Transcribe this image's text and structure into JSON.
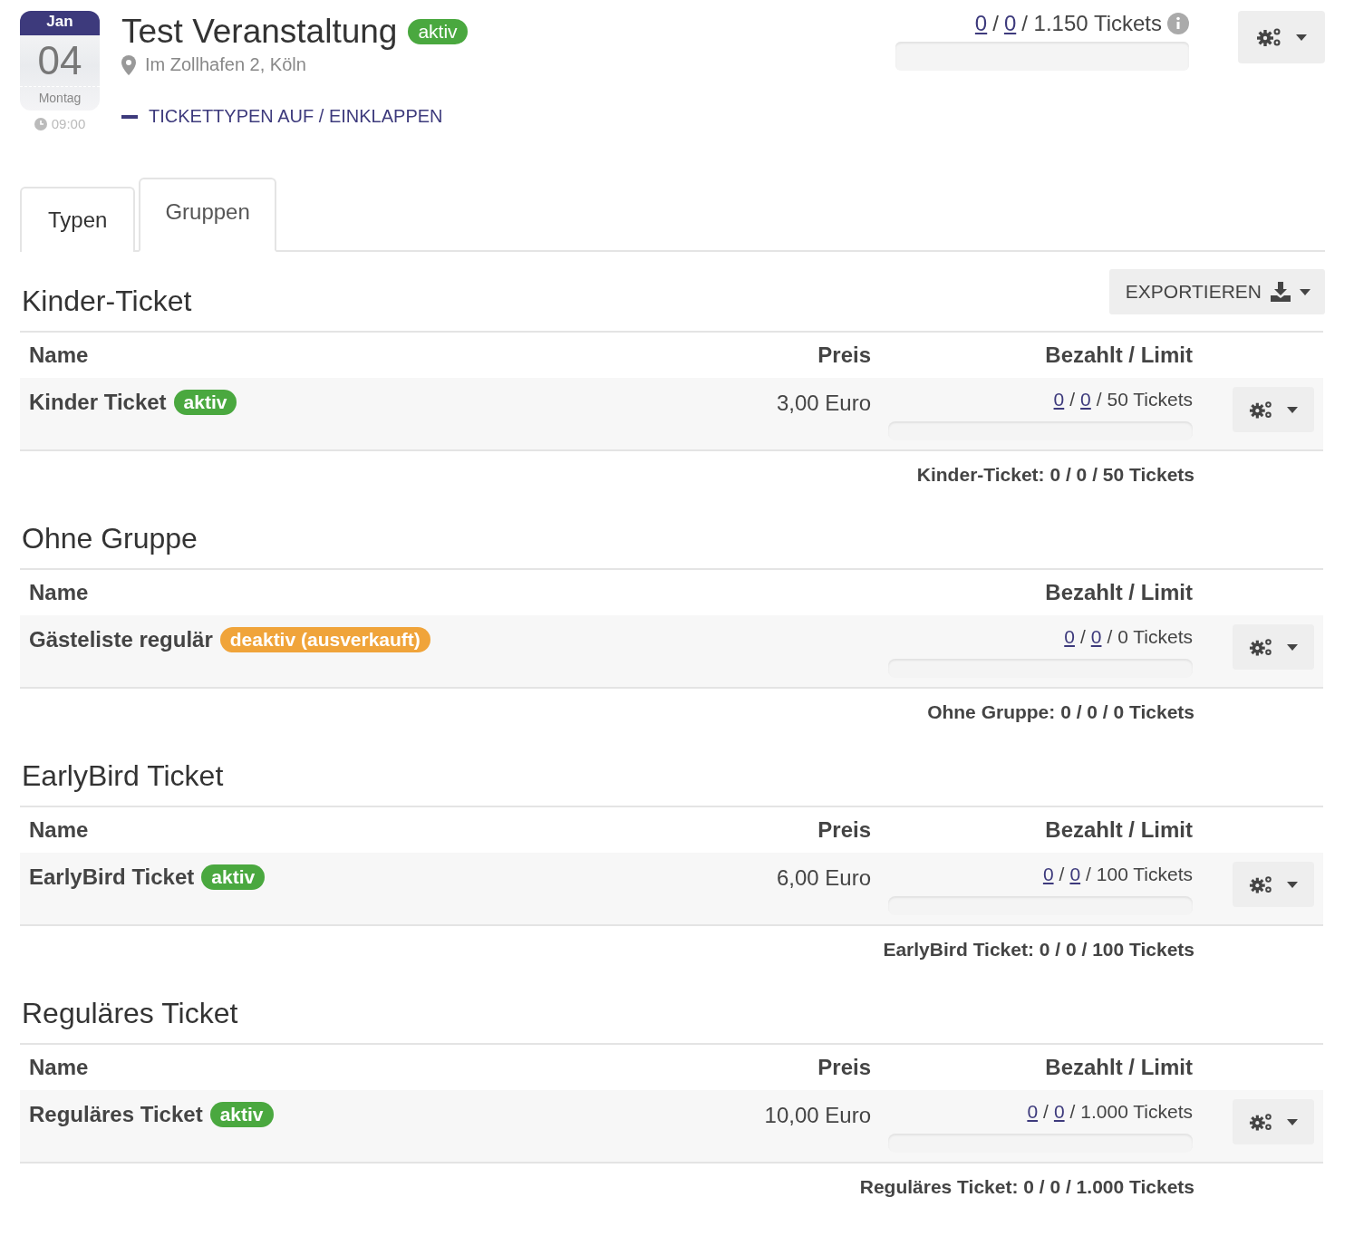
{
  "event": {
    "month": "Jan",
    "day": "04",
    "weekday": "Montag",
    "time": "09:00",
    "title": "Test Veranstaltung",
    "badge": {
      "label": "aktiv",
      "color": "#4aa83f"
    },
    "location": "Im Zollhafen 2, Köln",
    "toggle_link": "TICKETTYPEN AUF / EINKLAPPEN",
    "counts": [
      {
        "text": "0",
        "link": true
      },
      {
        "text": "/",
        "link": false
      },
      {
        "text": "0",
        "link": true
      },
      {
        "text": "/ 1.150 Tickets",
        "link": false
      }
    ],
    "level": 0
  },
  "tabs": [
    {
      "label": "Typen",
      "selected": false
    },
    {
      "label": "Gruppen",
      "selected": true
    }
  ],
  "export_button": "EXPORTIEREN",
  "groups": [
    {
      "title": "Kinder-Ticket",
      "columns": [
        "Name",
        "Preis",
        "Bezahlt / Limit"
      ],
      "rows": [
        {
          "name": "Kinder Ticket",
          "badge": {
            "label": "aktiv",
            "color": "#4aa83f"
          },
          "price": "3,00 Euro",
          "counts": [
            {
              "text": "0",
              "link": true
            },
            {
              "text": "/",
              "link": false
            },
            {
              "text": "0",
              "link": true
            },
            {
              "text": "/ 50 Tickets",
              "link": false
            }
          ],
          "level": 0
        }
      ],
      "summary": "Kinder-Ticket: 0 / 0 / 50 Tickets"
    },
    {
      "title": "Ohne Gruppe",
      "columns": [
        "Name",
        "Bezahlt / Limit"
      ],
      "rows": [
        {
          "name": "Gästeliste regulär",
          "badge": {
            "label": "deaktiv (ausverkauft)",
            "color": "#f0a43a"
          },
          "counts": [
            {
              "text": "0",
              "link": true
            },
            {
              "text": "/",
              "link": false
            },
            {
              "text": "0",
              "link": true
            },
            {
              "text": "/ 0 Tickets",
              "link": false
            }
          ],
          "level": 0
        }
      ],
      "summary": "Ohne Gruppe: 0 / 0 / 0 Tickets"
    },
    {
      "title": "EarlyBird Ticket",
      "columns": [
        "Name",
        "Preis",
        "Bezahlt / Limit"
      ],
      "rows": [
        {
          "name": "EarlyBird Ticket",
          "badge": {
            "label": "aktiv",
            "color": "#4aa83f"
          },
          "price": "6,00 Euro",
          "counts": [
            {
              "text": "0",
              "link": true
            },
            {
              "text": "/",
              "link": false
            },
            {
              "text": "0",
              "link": true
            },
            {
              "text": "/ 100 Tickets",
              "link": false
            }
          ],
          "level": 0
        }
      ],
      "summary": "EarlyBird Ticket: 0 / 0 / 100 Tickets"
    },
    {
      "title": "Reguläres Ticket",
      "columns": [
        "Name",
        "Preis",
        "Bezahlt / Limit"
      ],
      "rows": [
        {
          "name": "Reguläres Ticket",
          "badge": {
            "label": "aktiv",
            "color": "#4aa83f"
          },
          "price": "10,00 Euro",
          "counts": [
            {
              "text": "0",
              "link": true
            },
            {
              "text": "/",
              "link": false
            },
            {
              "text": "0",
              "link": true
            },
            {
              "text": "/ 1.000 Tickets",
              "link": false
            }
          ],
          "level": 0
        }
      ],
      "summary": "Reguläres Ticket: 0 / 0 / 1.000 Tickets"
    }
  ]
}
